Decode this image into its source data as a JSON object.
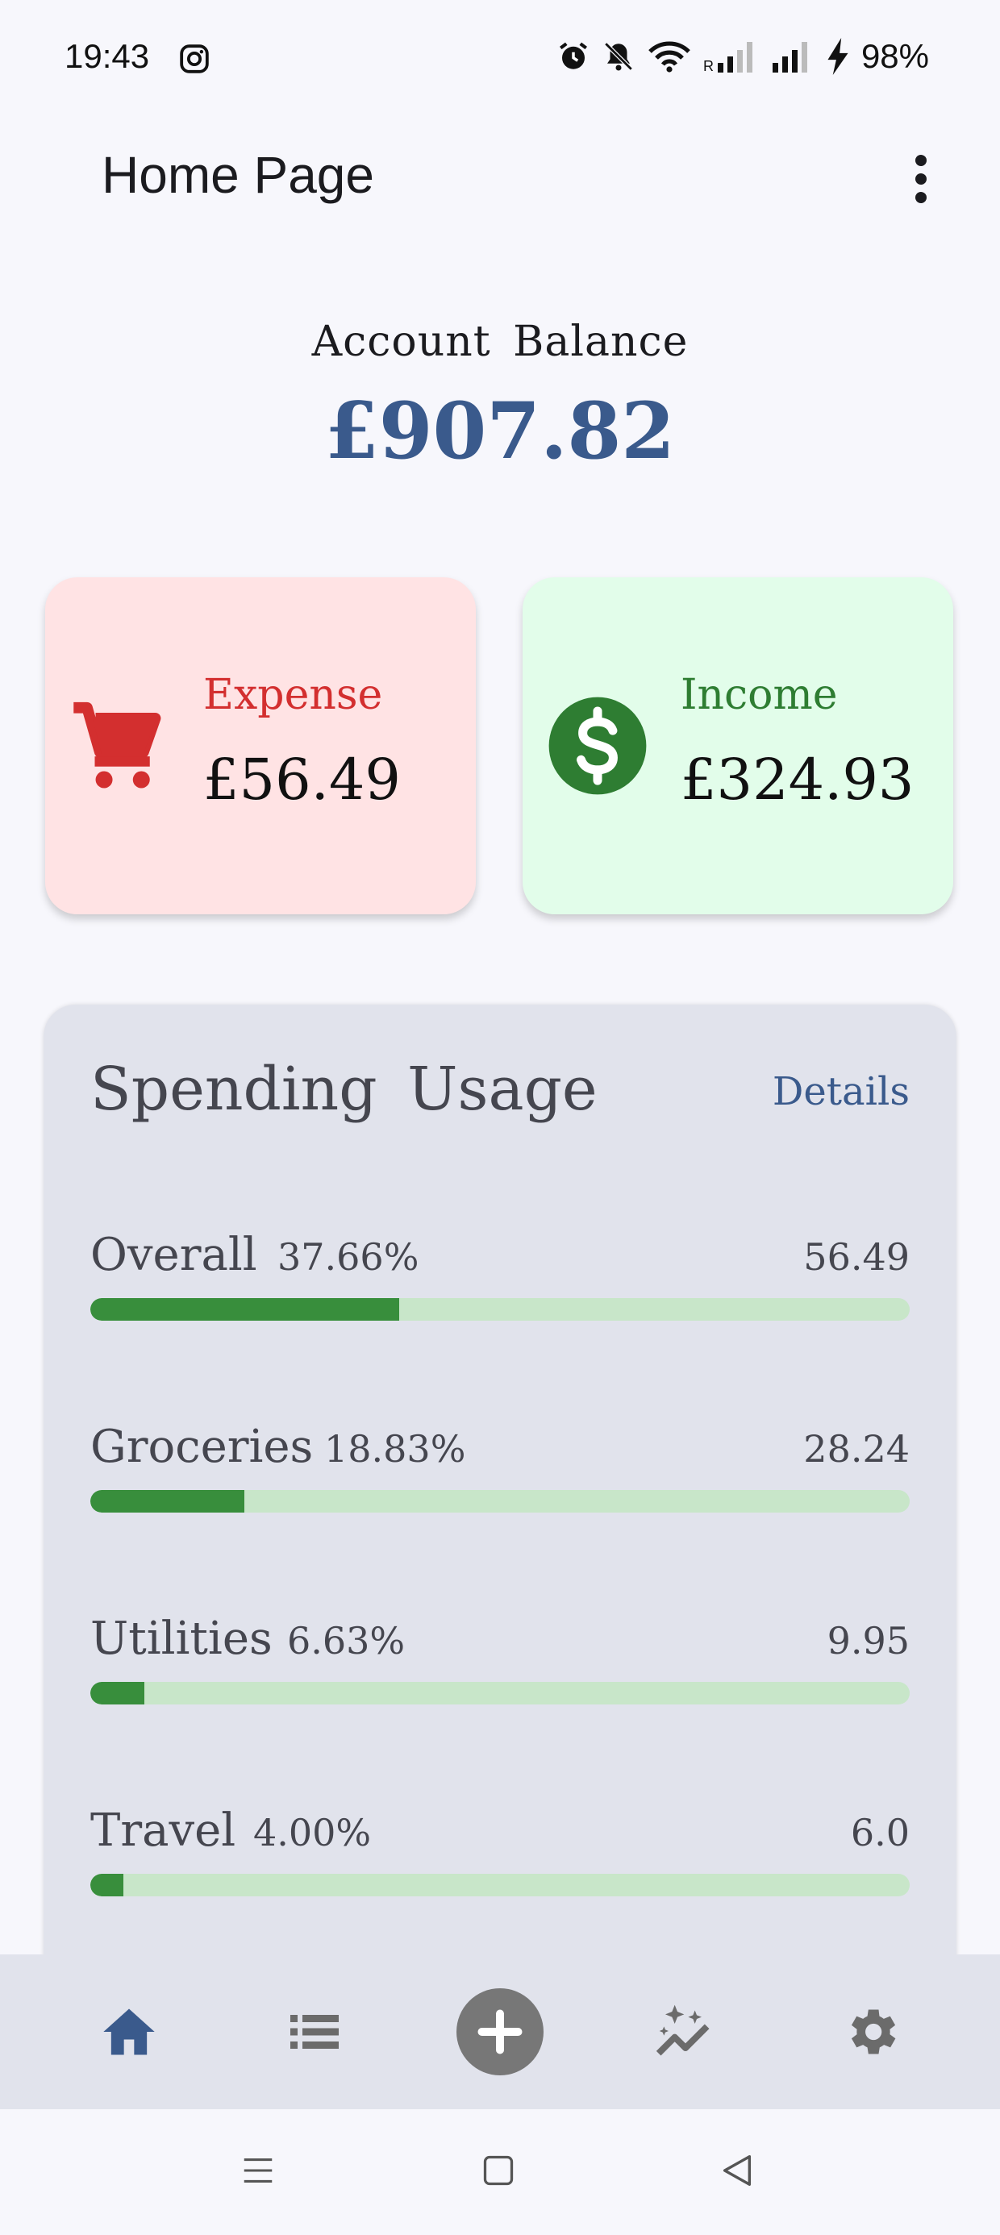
{
  "status_bar": {
    "time": "19:43",
    "battery": "98%",
    "icons": [
      "instagram-icon",
      "alarm-icon",
      "bell-off-icon",
      "wifi-icon",
      "signal-icon",
      "signal-icon",
      "charging-icon"
    ]
  },
  "app_bar": {
    "title": "Home Page",
    "menu_icon": "more-vert-icon"
  },
  "balance": {
    "label": "Account Balance",
    "amount": "£907.82"
  },
  "summary": {
    "expense": {
      "label": "Expense",
      "value": "£56.49",
      "icon": "cart-icon",
      "color": "#d32f2f"
    },
    "income": {
      "label": "Income",
      "value": "£324.93",
      "icon": "dollar-icon",
      "color": "#2e7d32"
    }
  },
  "spending": {
    "title": "Spending Usage",
    "details_label": "Details",
    "items": [
      {
        "name": "Overall",
        "percent": "37.66%",
        "amount": "56.49",
        "fraction": 0.3766
      },
      {
        "name": "Groceries",
        "percent": "18.83%",
        "amount": "28.24",
        "fraction": 0.1883
      },
      {
        "name": "Utilities",
        "percent": "6.63%",
        "amount": "9.95",
        "fraction": 0.0663
      },
      {
        "name": "Travel",
        "percent": "4.00%",
        "amount": "6.0",
        "fraction": 0.04
      }
    ]
  },
  "bottom_nav": {
    "items": [
      "home-icon",
      "list-icon",
      "add-icon",
      "insights-icon",
      "settings-icon"
    ],
    "active": "home-icon",
    "colors": {
      "active": "#3a5a8c",
      "inactive": "#6b6b6b",
      "bar_fill": "#388e3c",
      "bar_track": "#c8e6c9"
    }
  },
  "system_nav": {
    "items": [
      "recents-icon",
      "home-square-icon",
      "back-icon"
    ]
  }
}
